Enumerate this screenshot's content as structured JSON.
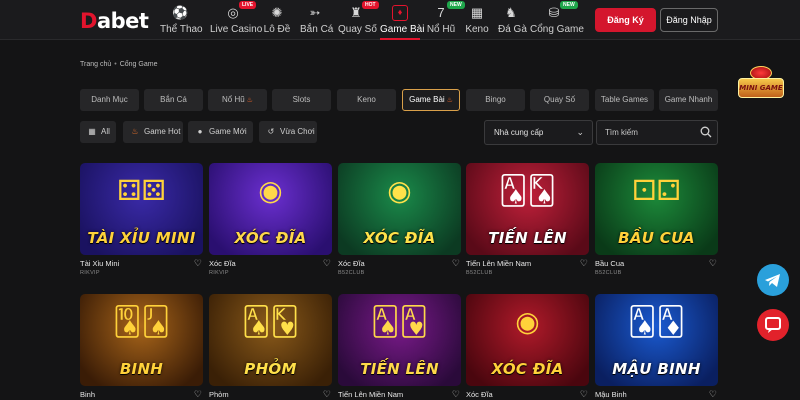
{
  "brand": {
    "logo_d": "D",
    "logo_rest": "abet"
  },
  "nav": [
    {
      "label": "Thể Thao",
      "icon": "soccer-ball-icon",
      "glyph": "⚽"
    },
    {
      "label": "Live Casino",
      "icon": "casino-chip-icon",
      "glyph": "◎",
      "badge": "LIVE"
    },
    {
      "label": "Lô Đề",
      "icon": "lottery-wheel-icon",
      "glyph": "✺"
    },
    {
      "label": "Bắn Cá",
      "icon": "fish-icon",
      "glyph": "➳"
    },
    {
      "label": "Quay Số",
      "icon": "lottery-ball-icon",
      "glyph": "♜",
      "badge": "HOT"
    },
    {
      "label": "Game Bài",
      "icon": "cards-icon",
      "glyph": "♦",
      "active": true
    },
    {
      "label": "Nổ Hũ",
      "icon": "slot-seven-icon",
      "glyph": "7",
      "badge": "NEW"
    },
    {
      "label": "Keno",
      "icon": "keno-grid-icon",
      "glyph": "▦"
    },
    {
      "label": "Đá Gà",
      "icon": "rooster-icon",
      "glyph": "♞"
    },
    {
      "label": "Cổng Game",
      "icon": "game-portal-icon",
      "glyph": "⛁",
      "badge": "NEW"
    }
  ],
  "auth": {
    "register": "Đăng Ký",
    "login": "Đăng Nhập"
  },
  "breadcrumb": {
    "home": "Trang chủ",
    "sep": "•",
    "current": "Cổng Game"
  },
  "categories": [
    {
      "label": "Danh Mục"
    },
    {
      "label": "Bắn Cá"
    },
    {
      "label": "Nổ Hũ",
      "hot": true
    },
    {
      "label": "Slots"
    },
    {
      "label": "Keno"
    },
    {
      "label": "Game Bài",
      "hot": true,
      "active": true
    },
    {
      "label": "Bingo"
    },
    {
      "label": "Quay Số"
    },
    {
      "label": "Table Games"
    },
    {
      "label": "Game Nhanh"
    }
  ],
  "filters": [
    {
      "label": "All",
      "icon": "grid-icon"
    },
    {
      "label": "Game Hot",
      "icon": "flame-icon",
      "active": true
    },
    {
      "label": "Game Mới",
      "icon": "new-badge-icon"
    },
    {
      "label": "Vừa Chơi",
      "icon": "history-icon"
    }
  ],
  "provider_select": {
    "value": "Nhà cung cấp"
  },
  "search": {
    "placeholder": "Tìm kiếm"
  },
  "games": [
    {
      "name": "Tài Xỉu Mini",
      "provider": "RIKVIP",
      "art": "TÀI XỈU MINI",
      "art_color": "#ffd23a",
      "bg1": "#3a2aa8",
      "bg2": "#1a1260",
      "deco": "⚃⚄"
    },
    {
      "name": "Xóc Đĩa",
      "provider": "RIKVIP",
      "art": "XÓC ĐĨA",
      "art_color": "#ffd84a",
      "bg1": "#6b2fd0",
      "bg2": "#2a0f70",
      "deco": "◉"
    },
    {
      "name": "Xóc Đĩa",
      "provider": "B52CLUB",
      "art": "XÓC ĐĨA",
      "art_color": "#ffe24a",
      "bg1": "#1a8a4a",
      "bg2": "#0c3a22",
      "deco": "◉"
    },
    {
      "name": "Tiến Lên Miền Nam",
      "provider": "B52CLUB",
      "art": "TIẾN LÊN",
      "art_color": "#ffffff",
      "bg1": "#c0203a",
      "bg2": "#5a0a18",
      "deco": "🂡🂮"
    },
    {
      "name": "Bầu Cua",
      "provider": "B52CLUB",
      "art": "BẦU CUA",
      "art_color": "#ffd23a",
      "bg1": "#1c8a3a",
      "bg2": "#0a3a18",
      "deco": "⚀⚁"
    },
    {
      "name": "Binh",
      "provider": "",
      "art": "BINH",
      "art_color": "#ffd23a",
      "bg1": "#a8651a",
      "bg2": "#3a1c06",
      "deco": "🂪🂫"
    },
    {
      "name": "Phỏm",
      "provider": "",
      "art": "PHỎM",
      "art_color": "#ffe04a",
      "bg1": "#8a5a1a",
      "bg2": "#3a2006",
      "deco": "🂡🂾"
    },
    {
      "name": "Tiến Lên Miền Nam",
      "provider": "",
      "art": "TIẾN LÊN",
      "art_color": "#ffd84a",
      "bg1": "#7a1a8a",
      "bg2": "#2a0a3a",
      "deco": "🂡🂱"
    },
    {
      "name": "Xóc Đĩa",
      "provider": "",
      "art": "XÓC ĐĨA",
      "art_color": "#ffd23a",
      "bg1": "#b01a2a",
      "bg2": "#4a060e",
      "deco": "◉"
    },
    {
      "name": "Mậu Binh",
      "provider": "",
      "art": "MẬU BINH",
      "art_color": "#ffffff",
      "bg1": "#1a5ad0",
      "bg2": "#0a1f60",
      "deco": "🂡🃁"
    }
  ],
  "widgets": {
    "minigame_label": "MINI GAME"
  },
  "colors": {
    "accent": "#e2142d",
    "active_border": "#d9a04a",
    "telegram": "#2aa0db",
    "messenger": "#e2222b"
  }
}
